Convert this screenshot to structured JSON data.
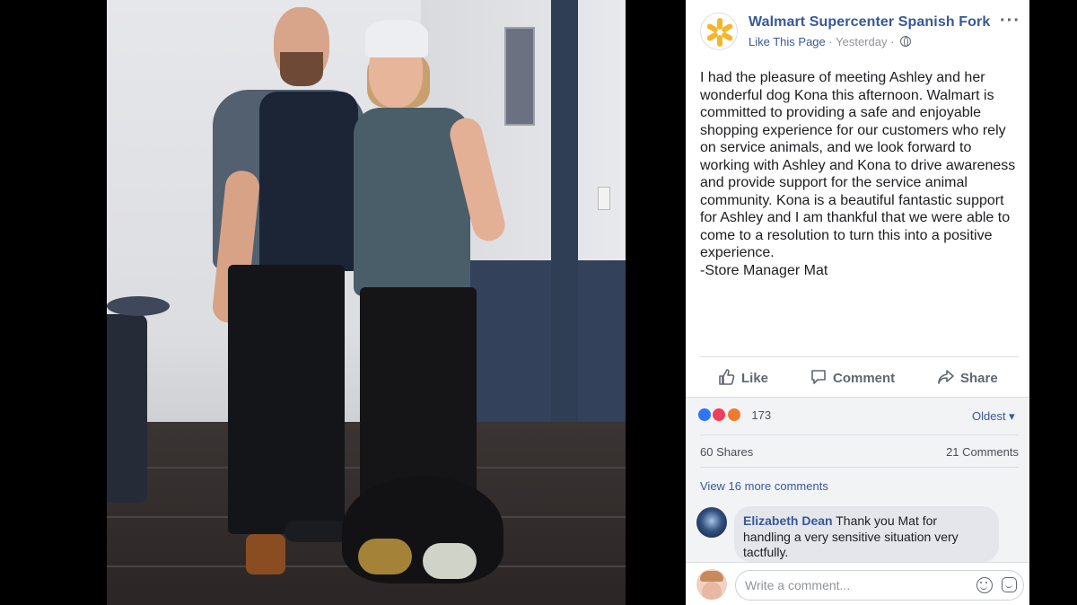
{
  "post": {
    "page_name": "Walmart Supercenter Spanish Fork",
    "like_page": "Like This Page",
    "separator": "·",
    "time": "Yesterday",
    "more": "···",
    "body_lines": [
      "I had the pleasure of meeting Ashley and her",
      "wonderful dog Kona this afternoon. Walmart is",
      "committed to providing a safe and enjoyable",
      "shopping experience for our customers who rely",
      "on service animals, and we look forward to",
      "working with Ashley and Kona to drive awareness",
      "and provide support for the service animal",
      "community. Kona is a beautiful fantastic support",
      "for Ashley and I am thankful that we were able to",
      "come to a resolution to turn this into a positive",
      "experience.",
      "-Store Manager Mat"
    ]
  },
  "actions": {
    "like": "Like",
    "comment": "Comment",
    "share": "Share"
  },
  "stats": {
    "reaction_count": "173",
    "sort": "Oldest ▾",
    "shares": "60 Shares",
    "comments": "21 Comments",
    "view_more": "View 16 more comments"
  },
  "comment": {
    "author": "Elizabeth Dean",
    "text_line1": "Thank you Mat for",
    "text_line2": "handling a very sensitive situation very",
    "text_line3": "tactfully."
  },
  "composer": {
    "placeholder": "Write a comment..."
  },
  "colors": {
    "link": "#385898",
    "like_blue": "#2f76f6",
    "love_red": "#f23e5c",
    "angry_orange": "#f07b30",
    "walmart_yellow": "#f5b62a"
  },
  "icons": [
    "walmart-spark-icon",
    "globe-icon",
    "more-icon",
    "like-thumb-icon",
    "comment-icon",
    "share-icon",
    "emoji-icon",
    "sticker-icon"
  ]
}
